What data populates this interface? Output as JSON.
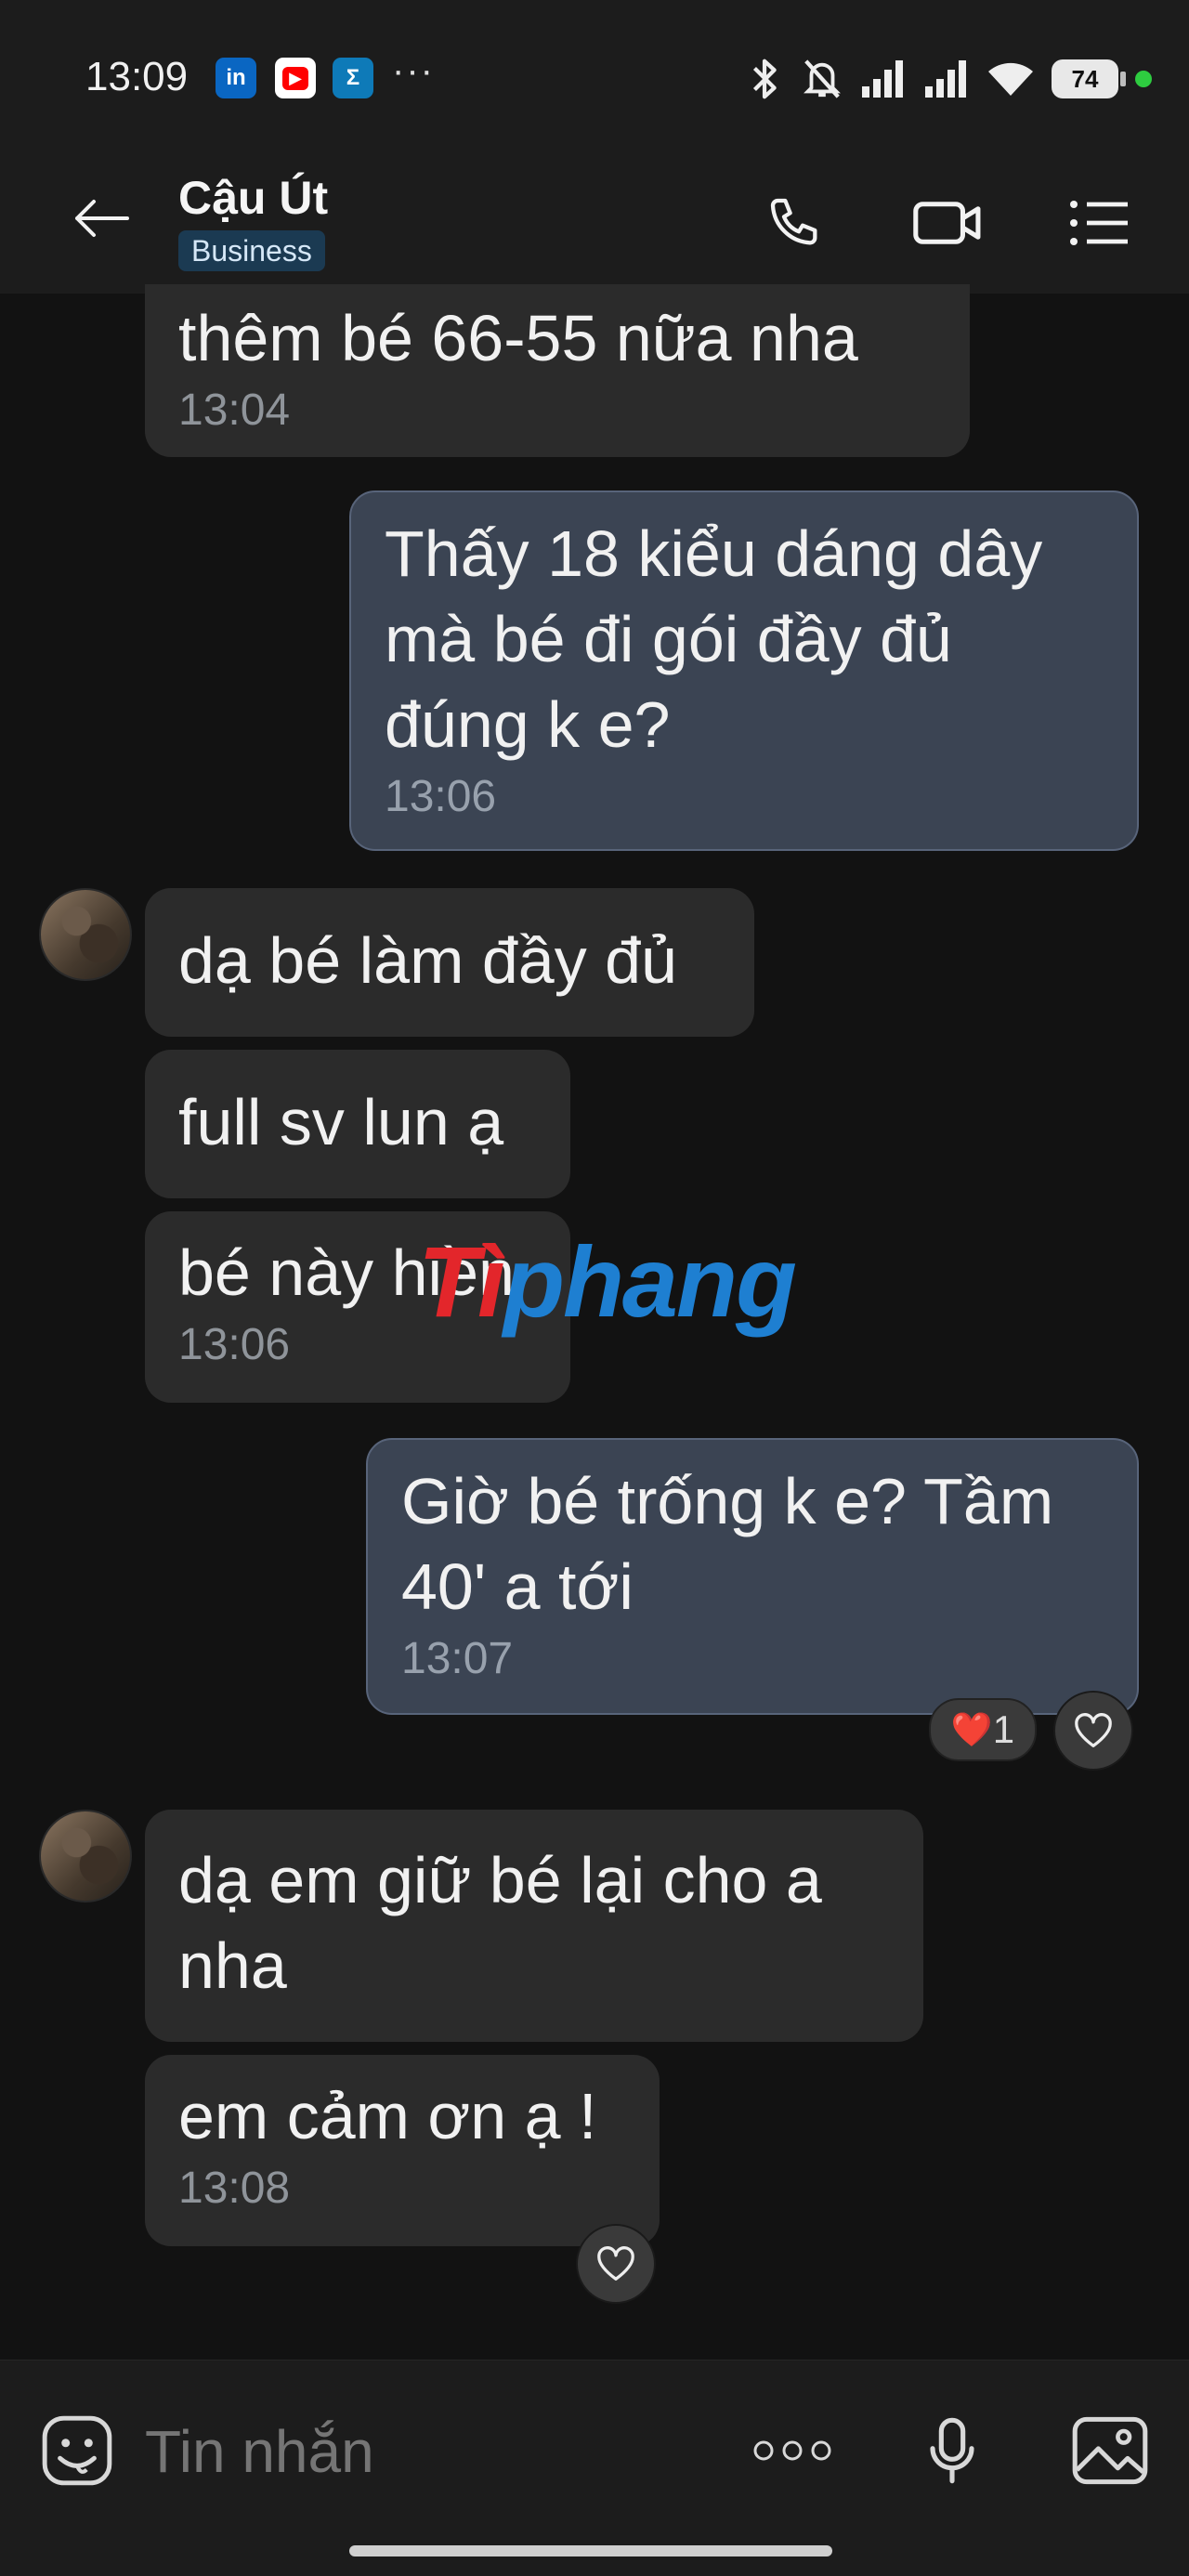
{
  "status_bar": {
    "time": "13:09",
    "apps": [
      {
        "name": "linkedin",
        "label": "in",
        "color": "#0a66c2"
      },
      {
        "name": "youtube",
        "label": "▶",
        "color": "#ff0000"
      },
      {
        "name": "sigma-app",
        "label": "Σ",
        "color": "#0e7ab8"
      }
    ],
    "more": "···",
    "battery": "74"
  },
  "header": {
    "contact_name": "Cậu Út",
    "badge": "Business"
  },
  "messages": [
    {
      "side": "in",
      "text": "thêm bé 66-55 nữa nha",
      "time": "13:04"
    },
    {
      "side": "out",
      "text": "Thấy 18 kiểu dáng dây mà bé đi gói đầy đủ đúng k e?",
      "time": "13:06"
    },
    {
      "side": "in",
      "text": "dạ bé làm đầy đủ",
      "time": ""
    },
    {
      "side": "in",
      "text": "full sv lun ạ",
      "time": ""
    },
    {
      "side": "in",
      "text": "bé này hiền",
      "time": "13:06"
    },
    {
      "side": "out",
      "text": "Giờ bé trống k e? Tầm 40' a tới",
      "time": "13:07",
      "reaction": {
        "emoji": "❤️",
        "count": "1"
      }
    },
    {
      "side": "in",
      "text": "dạ em giữ bé lại cho a nha",
      "time": ""
    },
    {
      "side": "in",
      "text": "em cảm ơn ạ !",
      "time": "13:08"
    }
  ],
  "watermark": {
    "part1": "Tì",
    "part2": "phang"
  },
  "composer": {
    "placeholder": "Tin nhắn"
  },
  "colors": {
    "incoming_bubble": "#2b2b2b",
    "outgoing_bubble": "#3b4453",
    "background": "#121212"
  }
}
